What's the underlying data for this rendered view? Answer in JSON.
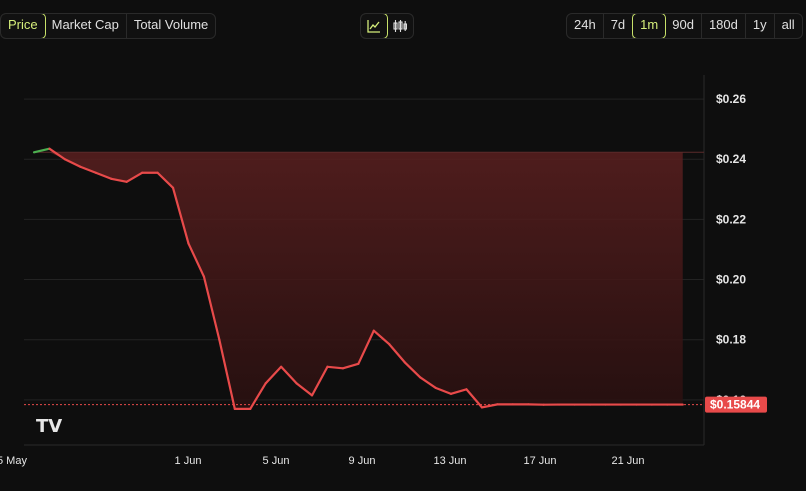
{
  "tabs": {
    "metric": [
      {
        "label": "Price",
        "active": true
      },
      {
        "label": "Market Cap",
        "active": false
      },
      {
        "label": "Total Volume",
        "active": false
      }
    ],
    "chart_type": [
      {
        "icon": "line-chart-icon",
        "active": true
      },
      {
        "icon": "candlestick-icon",
        "active": false
      }
    ],
    "range": [
      {
        "label": "24h",
        "active": false
      },
      {
        "label": "7d",
        "active": false
      },
      {
        "label": "1m",
        "active": true
      },
      {
        "label": "90d",
        "active": false
      },
      {
        "label": "180d",
        "active": false
      },
      {
        "label": "1y",
        "active": false
      },
      {
        "label": "all",
        "active": false
      }
    ]
  },
  "current_price_label": "$0.15844",
  "watermark": "TV",
  "colors": {
    "accent": "#c8e26a",
    "up": "#4caf50",
    "down": "#e84a4a",
    "price_tag": "#e84a4a"
  },
  "chart_data": {
    "type": "line",
    "y_ticks": [
      "$0.26",
      "$0.24",
      "$0.22",
      "$0.20",
      "$0.18",
      "$0.16"
    ],
    "y_tick_values": [
      0.26,
      0.24,
      0.22,
      0.2,
      0.18,
      0.16
    ],
    "ylim": [
      0.145,
      0.268
    ],
    "x_ticks": [
      "5 May",
      "1 Jun",
      "5 Jun",
      "9 Jun",
      "13 Jun",
      "17 Jun",
      "21 Jun"
    ],
    "x_tick_positions": [
      0,
      7,
      9,
      11,
      13,
      15,
      17
    ],
    "xlim": [
      0,
      21.3
    ],
    "baseline": 0.2423,
    "current_value": 0.15844,
    "grid": true,
    "series": [
      {
        "x": [
          0,
          0.5,
          1,
          1.5,
          2,
          2.5,
          3,
          3.5,
          4,
          4.5,
          5,
          5.5,
          6,
          6.5,
          7,
          7.5,
          8,
          8.5,
          9,
          9.5,
          10,
          10.5,
          11,
          11.5,
          12,
          12.5,
          13,
          13.5,
          14,
          14.5,
          15,
          15.5,
          16,
          16.5,
          17,
          17.5,
          18,
          18.5,
          19,
          19.5,
          20,
          20.5,
          21
        ],
        "y": [
          0.2423,
          0.2435,
          0.24,
          0.2375,
          0.2355,
          0.2335,
          0.2325,
          0.2355,
          0.2355,
          0.2305,
          0.212,
          0.201,
          0.18,
          0.157,
          0.157,
          0.1655,
          0.171,
          0.1655,
          0.1615,
          0.171,
          0.1705,
          0.172,
          0.183,
          0.1785,
          0.1725,
          0.1675,
          0.164,
          0.162,
          0.1635,
          0.1575,
          0.1585,
          0.1585,
          0.1585,
          0.1584,
          0.15844,
          0.15844,
          0.15844,
          0.15844,
          0.15844,
          0.15844,
          0.15844,
          0.15844,
          0.15844
        ]
      }
    ]
  }
}
